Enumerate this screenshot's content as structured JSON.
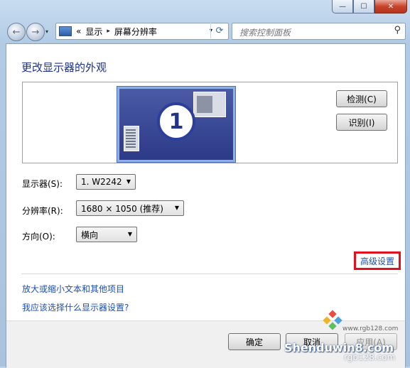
{
  "window": {
    "min_glyph": "—",
    "max_glyph": "☐",
    "close_glyph": "✕"
  },
  "nav": {
    "back_glyph": "←",
    "forward_glyph": "→",
    "history_glyph": "▾",
    "address": {
      "prefix": "«",
      "crumb1": "显示",
      "sep": "▸",
      "crumb2": "屏幕分辨率",
      "dropdown": "▾"
    },
    "refresh_glyph": "⟳",
    "search_placeholder": "搜索控制面板",
    "search_glyph": "⚲"
  },
  "page": {
    "title": "更改显示器的外观",
    "monitor_number": "1",
    "detect_button": "检测(C)",
    "identify_button": "识别(I)",
    "display_label": "显示器(S):",
    "display_value": "1. W2242",
    "resolution_label": "分辨率(R):",
    "resolution_value": "1680 × 1050 (推荐)",
    "orientation_label": "方向(O):",
    "orientation_value": "横向",
    "advanced_link": "高级设置",
    "link_text_size": "放大或缩小文本和其他项目",
    "link_which_settings": "我应该选择什么显示器设置?",
    "ok_button": "确定",
    "cancel_button": "取消",
    "apply_button": "应用(A)"
  },
  "watermark": {
    "site": "www.rgb128.com",
    "brand": "Shenduwin8.com",
    "sub": "rgb128.com"
  },
  "colors": {
    "link": "#1d4fb0",
    "heading": "#1e3287",
    "highlight_box": "#e0101c"
  }
}
